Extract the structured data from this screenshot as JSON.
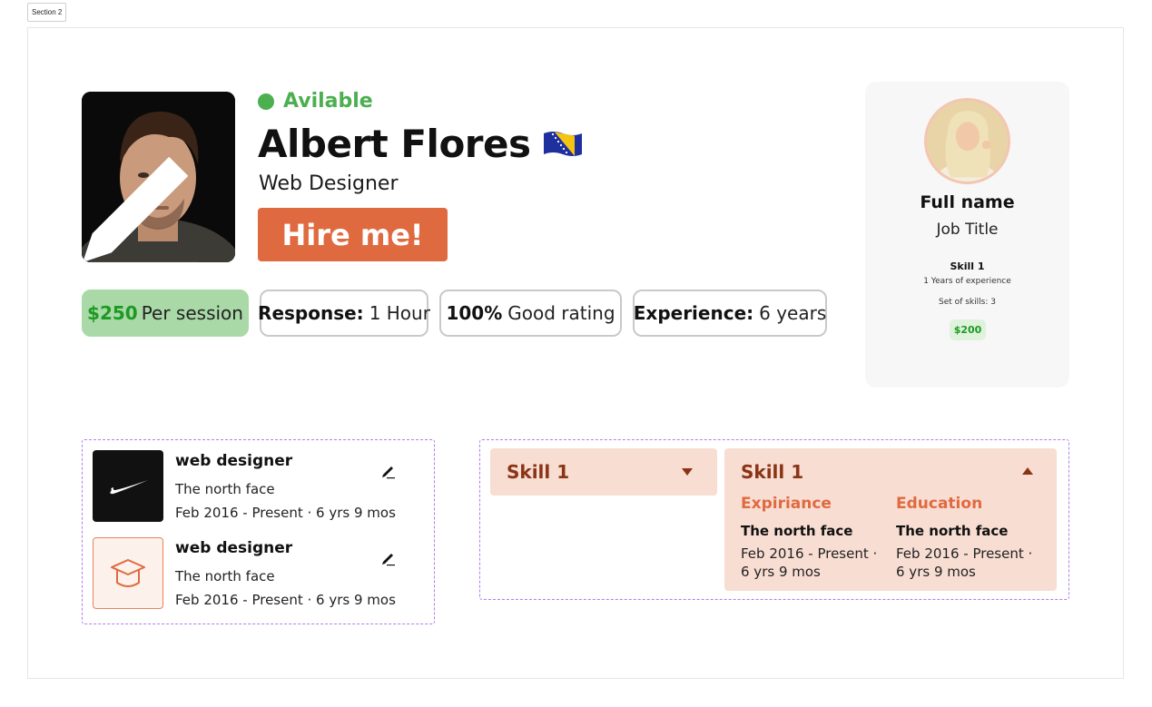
{
  "section_label": "Section 2",
  "profile": {
    "status": "Avilable",
    "name": "Albert Flores",
    "job_title": "Web Designer",
    "hire_label": "Hire me!",
    "colors": {
      "accent": "#e06a3f",
      "available": "#4caf50",
      "price_bg": "#a9d9a7"
    }
  },
  "stats": {
    "price_value": "$250",
    "price_label": "Per session",
    "response_label": "Response:",
    "response_value": "1 Hour",
    "rating_value": "100%",
    "rating_label": "Good rating",
    "experience_label": "Experience:",
    "experience_value": "6 years"
  },
  "side_card": {
    "name": "Full name",
    "job": "Job Title",
    "skill": "Skill 1",
    "experience": "1 Years of experience",
    "set_of_skills": "Set of skills: 3",
    "price": "$200"
  },
  "experience_list": [
    {
      "icon": "nike-logo-icon",
      "title": "web designer",
      "company": "The north face",
      "dates": "Feb 2016 - Present · 6 yrs 9 mos"
    },
    {
      "icon": "graduation-cap-icon",
      "title": "web designer",
      "company": "The north face",
      "dates": "Feb 2016 - Present · 6 yrs 9 mos"
    }
  ],
  "skills": {
    "collapsed": {
      "title": "Skill 1"
    },
    "expanded": {
      "title": "Skill 1",
      "col1_head": "Expiriance",
      "col1_company": "The north face",
      "col1_dates": "Feb 2016 - Present · 6 yrs 9 mos",
      "col2_head": "Education",
      "col2_company": "The north face",
      "col2_dates": "Feb 2016 - Present · 6 yrs 9 mos"
    }
  }
}
